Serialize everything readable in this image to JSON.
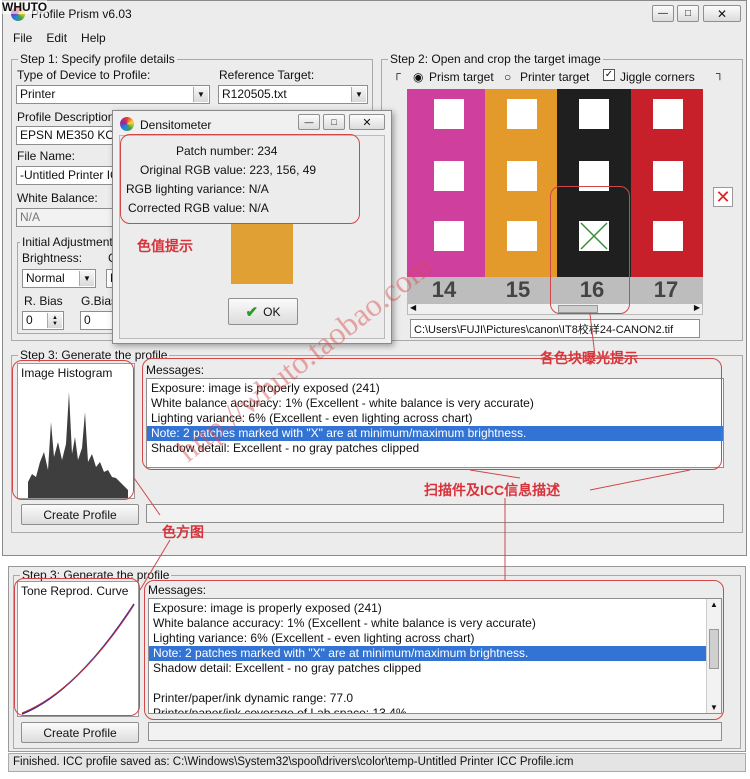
{
  "watermark_top": "WHUTO",
  "main_window": {
    "title": "Profile Prism v6.03",
    "menu": [
      "File",
      "Edit",
      "Help"
    ],
    "step1": {
      "title": "Step 1: Specify profile details",
      "device_label": "Type of Device to Profile:",
      "device_value": "Printer",
      "reference_label": "Reference Target:",
      "reference_value": "R120505.txt",
      "description_label": "Profile Description",
      "description_value": "EPSN ME350 KO",
      "filename_label": "File Name:",
      "filename_value": "-Untitled Printer IC",
      "white_balance_label": "White Balance:",
      "white_balance_value": "N/A",
      "initial_adjust_label": "Initial Adjustment",
      "brightness_label": "Brightness:",
      "brightness_value": "Normal",
      "c_label": "C",
      "c_value": "N",
      "rbias_label": "R. Bias",
      "rbias_value": "0",
      "gbias_label": "G.Bias",
      "gbias_value": "0"
    },
    "step2": {
      "title": "Step 2: Open and crop the target image",
      "prism_target": "Prism target",
      "printer_target": "Printer target",
      "jiggle_corners": "Jiggle corners",
      "path_value": "C:\\Users\\FUJI\\Pictures\\canon\\IT8校样24-CANON2.tif",
      "ruler_numbers": [
        "14",
        "15",
        "16",
        "17"
      ]
    },
    "step3": {
      "title": "Step 3: Generate the profile",
      "histogram_label": "Image Histogram",
      "messages_label": "Messages:",
      "messages": [
        "Exposure: image is properly exposed (241)",
        "White balance accuracy:  1% (Excellent - white balance is very accurate)",
        "Lighting variance:  6% (Excellent - even lighting across chart)",
        "Note: 2 patches marked with \"X\" are at minimum/maximum brightness.",
        "Shadow detail: Excellent - no gray patches clipped"
      ],
      "create_button": "Create Profile"
    }
  },
  "densitometer": {
    "title": "Densitometer",
    "patch_number": "Patch number: 234",
    "original_rgb": "Original RGB value: 223, 156, 49",
    "lighting_variance": "RGB lighting variance: N/A",
    "corrected_rgb": "Corrected RGB value: N/A",
    "swatch_color": "#e1a033",
    "ok_button": "OK"
  },
  "lower_panel": {
    "title": "Step 3: Generate the profile",
    "curve_label": "Tone Reprod. Curve",
    "messages_label": "Messages:",
    "messages": [
      "Exposure: image is properly exposed (241)",
      "White balance accuracy:  1% (Excellent - white balance is very accurate)",
      "Lighting variance:  6% (Excellent - even lighting across chart)",
      "Note: 2 patches marked with \"X\" are at minimum/maximum brightness.",
      "Shadow detail: Excellent - no gray patches clipped",
      "",
      "Printer/paper/ink dynamic range: 77.0",
      "Printer/paper/ink coverage of Lab space: 13.4%"
    ],
    "create_button": "Create Profile"
  },
  "status_bar": "Finished.  ICC profile saved as: C:\\Windows\\System32\\spool\\drivers\\color\\temp-Untitled Printer ICC Profile.icm",
  "annotations": {
    "color_value_hint": "色值提示",
    "patch_exposure_hint": "各色块曝光提示",
    "scan_icc_info": "扫描件及ICC信息描述",
    "histogram": "色方图",
    "watermark_url": "http://whuto.taobao.com"
  },
  "colors": {
    "selection": "#3373d4",
    "annotation_red": "#d8323b",
    "patch_magenta": "#cf3f9e",
    "patch_orange": "#e39a2a",
    "patch_black": "#1f1f1f",
    "patch_red": "#c8202a"
  }
}
